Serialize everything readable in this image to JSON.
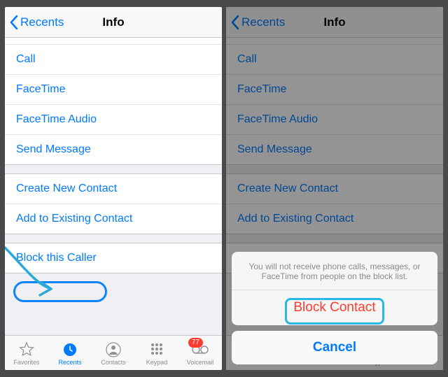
{
  "nav": {
    "back": "Recents",
    "title": "Info"
  },
  "actions": {
    "call": "Call",
    "facetime": "FaceTime",
    "facetime_audio": "FaceTime Audio",
    "send_message": "Send Message",
    "create_contact": "Create New Contact",
    "add_existing": "Add to Existing Contact",
    "block": "Block this Caller"
  },
  "tabs": {
    "favorites": "Favorites",
    "recents": "Recents",
    "contacts": "Contacts",
    "keypad": "Keypad",
    "voicemail": "Voicemail",
    "voicemail_badge": "77"
  },
  "sheet": {
    "message": "You will not receive phone calls, messages, or FaceTime from people on the block list.",
    "block_contact": "Block Contact",
    "cancel": "Cancel"
  }
}
